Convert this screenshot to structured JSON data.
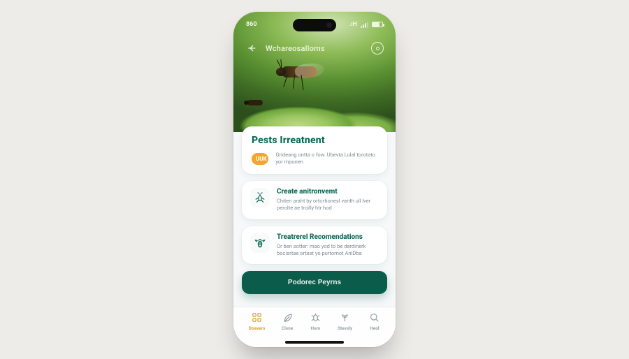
{
  "status": {
    "time": "860",
    "network_label": ".ıH"
  },
  "appbar": {
    "title": "Wchareosalloms"
  },
  "cards": {
    "main": {
      "title": "Pests Irreatnent",
      "badge": "UUK",
      "desc": "Grideang ontta o fow. Ubevta Lulal torotato yor mponen"
    },
    "second": {
      "title": "Create anitronvemt",
      "desc": "Chiten araht by ortortionesl vanth ull lver perolte ae troilly htr hod"
    },
    "third": {
      "title": "Treatrerel Recomendations",
      "desc": "Or ben sotter: mao yod to be derdinerk bocisrtae ortest yo purtornot AnlDba"
    }
  },
  "cta": {
    "label": "Podorec Peyrns"
  },
  "tabs": [
    {
      "label": "Doavers"
    },
    {
      "label": "Cisne"
    },
    {
      "label": "Hsm"
    },
    {
      "label": "Stevsly"
    },
    {
      "label": "Heol"
    }
  ]
}
